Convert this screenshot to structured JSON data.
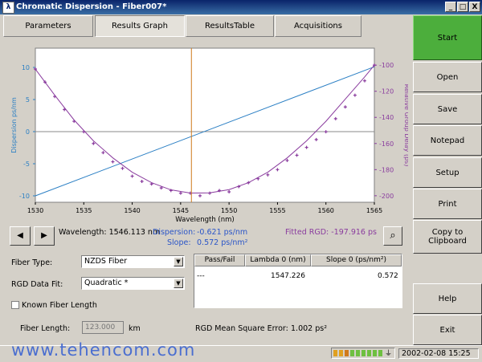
{
  "window": {
    "title": "Chromatic Dispersion - Fiber007*",
    "minimize": "_",
    "maximize": "□",
    "close": "X"
  },
  "tabs": [
    {
      "label": "Parameters"
    },
    {
      "label": "Results Graph"
    },
    {
      "label": "ResultsTable"
    },
    {
      "label": "Acquisitions"
    }
  ],
  "sidebar": {
    "start": "Start",
    "open": "Open",
    "save": "Save",
    "notepad": "Notepad",
    "setup": "Setup",
    "print": "Print",
    "copy": "Copy to Clipboard",
    "help": "Help",
    "exit": "Exit"
  },
  "readout": {
    "prev": "◀",
    "next": "▶",
    "wavelength": "Wavelength: 1546.113 nm",
    "dispersion_label": "Dispersion:",
    "dispersion_value": "-0.621 ps/nm",
    "slope_label": "Slope:",
    "slope_value": "0.572 ps/nm²",
    "fitted_rgd": "Fitted RGD: -197.916 ps"
  },
  "form": {
    "fiber_type_label": "Fiber Type:",
    "fiber_type_value": "NZDS Fiber",
    "rgd_fit_label": "RGD Data Fit:",
    "rgd_fit_value": "Quadratic *",
    "known_length_label": "Known Fiber Length",
    "fiber_length_label": "Fiber Length:",
    "fiber_length_placeholder": "123.000",
    "fiber_length_unit": "km",
    "rgd_mse_label": "RGD Mean Square Error:",
    "rgd_mse_value": "1.002 ps²"
  },
  "table": {
    "headers": [
      "Pass/Fail",
      "Lambda 0 (nm)",
      "Slope 0 (ps/nm²)"
    ],
    "row": [
      "---",
      "1547.226",
      "0.572"
    ]
  },
  "status": {
    "datetime": "2002-02-08 15:25",
    "watermark": "www.tehencom.com"
  },
  "colors": {
    "accent": "#4cae3c",
    "dispersion": "#2a7fc4",
    "rgd": "#8a3c9e",
    "marker": "#d07a1c"
  },
  "chart_data": {
    "type": "line",
    "xlabel": "Wavelength (nm)",
    "ylabel_left": "Dispersion ps/nm",
    "ylabel_right": "Relative Group Delay (ps)",
    "xlim": [
      1530,
      1565
    ],
    "ylim_left": [
      -11,
      13
    ],
    "ylim_right": [
      -205,
      -87
    ],
    "x_ticks": [
      1530,
      1535,
      1540,
      1545,
      1550,
      1555,
      1560,
      1565
    ],
    "left_ticks": [
      -10,
      -5,
      0,
      5,
      10
    ],
    "right_ticks": [
      -200,
      -180,
      -160,
      -140,
      -120,
      -100
    ],
    "cursor_x": 1546.113,
    "series": [
      {
        "axis": "left",
        "kind": "line",
        "x": [
          1530,
          1565
        ],
        "y": [
          -10,
          10.1
        ]
      },
      {
        "axis": "right",
        "kind": "fit",
        "x": [
          1530,
          1532,
          1534,
          1536,
          1538,
          1540,
          1542,
          1544,
          1546,
          1548,
          1550,
          1552,
          1554,
          1556,
          1558,
          1560,
          1562,
          1564,
          1565
        ],
        "y": [
          -103,
          -123,
          -142,
          -158,
          -171,
          -182,
          -190,
          -195.5,
          -197.9,
          -197.8,
          -195.3,
          -190,
          -182,
          -171,
          -158,
          -143,
          -126,
          -109,
          -100
        ]
      },
      {
        "axis": "right",
        "kind": "points",
        "x": [
          1530,
          1531,
          1532,
          1533,
          1534,
          1535,
          1536,
          1537,
          1538,
          1539,
          1540,
          1541,
          1542,
          1543,
          1544,
          1545,
          1546,
          1547,
          1548,
          1549,
          1550,
          1551,
          1552,
          1553,
          1554,
          1555,
          1556,
          1557,
          1558,
          1559,
          1560,
          1561,
          1562,
          1563,
          1564,
          1565
        ],
        "y": [
          -103,
          -113,
          -124,
          -134,
          -143,
          -151,
          -160,
          -167,
          -174,
          -179,
          -185,
          -189,
          -191,
          -194,
          -196,
          -198,
          -198,
          -200,
          -198,
          -196,
          -197,
          -193,
          -190,
          -187,
          -184,
          -180,
          -173,
          -169,
          -163,
          -157,
          -151,
          -141,
          -132,
          -123,
          -112,
          -100
        ]
      }
    ]
  }
}
